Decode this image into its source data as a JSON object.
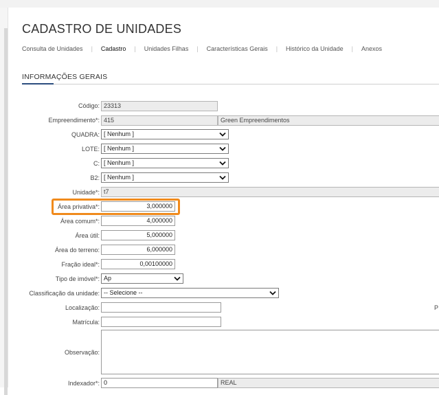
{
  "page": {
    "title": "CADASTRO DE UNIDADES"
  },
  "tabs": [
    "Consulta de Unidades",
    "Cadastro",
    "Unidades Filhas",
    "Características Gerais",
    "Histórico da Unidade",
    "Anexos"
  ],
  "section": {
    "title": "INFORMAÇÕES GERAIS"
  },
  "form": {
    "codigo": {
      "label": "Código:",
      "value": "23313"
    },
    "empreendimento": {
      "label": "Empreendimento*:",
      "code": "415",
      "name": "Green Empreendimentos"
    },
    "quadra": {
      "label": "QUADRA:",
      "value": "[ Nenhum ]"
    },
    "lote": {
      "label": "LOTE:",
      "value": "[ Nenhum ]"
    },
    "c": {
      "label": "C:",
      "value": "[ Nenhum ]"
    },
    "b2": {
      "label": "B2:",
      "value": "[ Nenhum ]"
    },
    "unidade": {
      "label": "Unidade*:",
      "value": "t7"
    },
    "area_privativa": {
      "label": "Área privativa*:",
      "value": "3,000000"
    },
    "area_comum": {
      "label": "Área comum*:",
      "value": "4,000000"
    },
    "area_util": {
      "label": "Área útil:",
      "value": "5,000000"
    },
    "area_terreno": {
      "label": "Área do terreno:",
      "value": "6,000000"
    },
    "fracao_ideal": {
      "label": "Fração ideal*:",
      "value": "0,00100000"
    },
    "tipo_imovel": {
      "label": "Tipo de imóvel*:",
      "value": "Ap"
    },
    "classificacao": {
      "label": "Classificação da unidade:",
      "value": "-- Selecione --"
    },
    "localizacao": {
      "label": "Localização:",
      "value": ""
    },
    "matricula": {
      "label": "Matrícula:",
      "value": ""
    },
    "observacao": {
      "label": "Observação:",
      "value": ""
    },
    "indexador": {
      "label": "Indexador*:",
      "code": "0",
      "name": "REAL"
    }
  },
  "cut_off_label": "P",
  "colors": {
    "highlight": "#f08a1c",
    "accent": "#2b4d7e"
  }
}
